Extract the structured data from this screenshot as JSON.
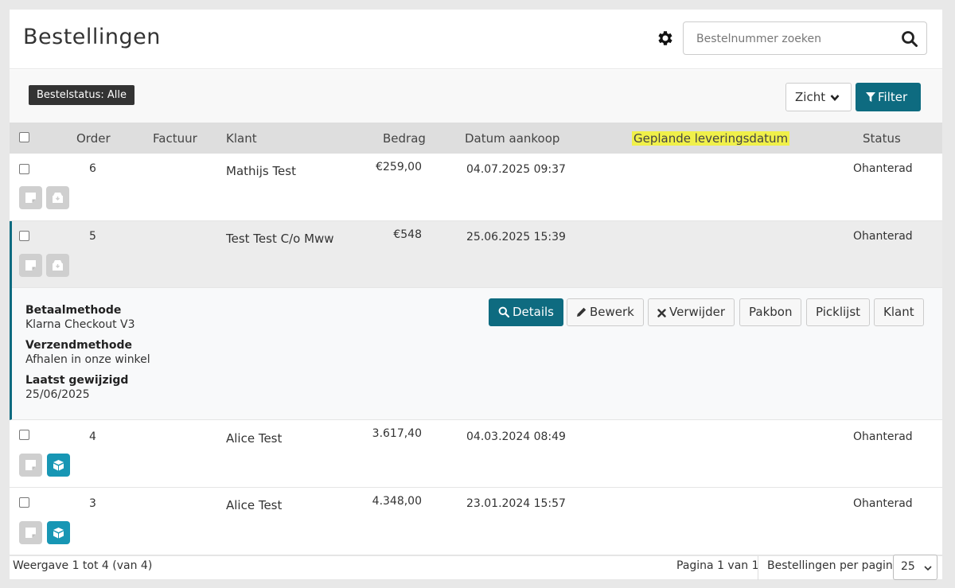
{
  "header": {
    "title": "Bestellingen",
    "search_placeholder": "Bestelnummer zoeken"
  },
  "filterbar": {
    "status_pill": "Bestelstatus: Alle",
    "view_label": "Zicht",
    "filter_label": "Filter"
  },
  "columns": {
    "order": "Order",
    "invoice": "Factuur",
    "customer": "Klant",
    "amount": "Bedrag",
    "purchase_date": "Datum aankoop",
    "planned_delivery": "Geplande leveringsdatum",
    "status": "Status"
  },
  "rows": [
    {
      "order": "6",
      "invoice": "",
      "customer": "Mathijs Test",
      "amount": "€259,00",
      "purchase_date": "04.07.2025 09:37",
      "planned_delivery": "",
      "status": "Ohanterad"
    },
    {
      "order": "5",
      "invoice": "",
      "customer": "Test Test C/o Mww",
      "amount": "€548",
      "purchase_date": "25.06.2025 15:39",
      "planned_delivery": "",
      "status": "Ohanterad"
    },
    {
      "order": "4",
      "invoice": "",
      "customer": "Alice Test",
      "amount": "3.617,40",
      "purchase_date": "04.03.2024 08:49",
      "planned_delivery": "",
      "status": "Ohanterad"
    },
    {
      "order": "3",
      "invoice": "",
      "customer": "Alice Test",
      "amount": "4.348,00",
      "purchase_date": "23.01.2024 15:57",
      "planned_delivery": "",
      "status": "Ohanterad"
    }
  ],
  "detail": {
    "payment_label": "Betaalmethode",
    "payment_value": "Klarna Checkout V3",
    "shipping_label": "Verzendmethode",
    "shipping_value": "Afhalen in onze winkel",
    "modified_label": "Laatst gewijzigd",
    "modified_value": "25/06/2025",
    "actions": {
      "details": "Details",
      "edit": "Bewerk",
      "delete": "Verwijder",
      "packing_slip": "Pakbon",
      "pick_list": "Picklijst",
      "customer": "Klant"
    }
  },
  "footer": {
    "showing": "Weergave 1 tot 4 (van 4)",
    "page": "Pagina 1 van 1",
    "per_page_label": "Bestellingen per pagina",
    "per_page_value": "25"
  },
  "colors": {
    "accent": "#0e6b80",
    "icon_blue": "#1796b4",
    "highlight": "#f0f04a"
  }
}
